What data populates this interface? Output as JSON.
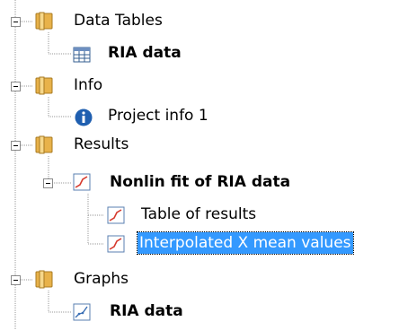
{
  "tree": {
    "sections": [
      {
        "label": "Data Tables",
        "children": [
          {
            "label": "RIA data",
            "bold": true,
            "icon": "data-table-icon"
          }
        ]
      },
      {
        "label": "Info",
        "children": [
          {
            "label": "Project info 1",
            "bold": false,
            "icon": "info-icon"
          }
        ]
      },
      {
        "label": "Results",
        "children": [
          {
            "label": "Nonlin fit of RIA data",
            "bold": true,
            "icon": "results-icon",
            "children": [
              {
                "label": "Table of results",
                "icon": "results-icon"
              },
              {
                "label": "Interpolated X mean values",
                "icon": "results-icon",
                "selected": true
              }
            ]
          }
        ]
      },
      {
        "label": "Graphs",
        "children": [
          {
            "label": "RIA data",
            "bold": true,
            "icon": "graph-icon"
          }
        ]
      }
    ]
  },
  "colors": {
    "selection": "#3399ff",
    "folder": "#e8b24a",
    "info": "#1f5fb0",
    "chart_line": "#d63a2e"
  }
}
